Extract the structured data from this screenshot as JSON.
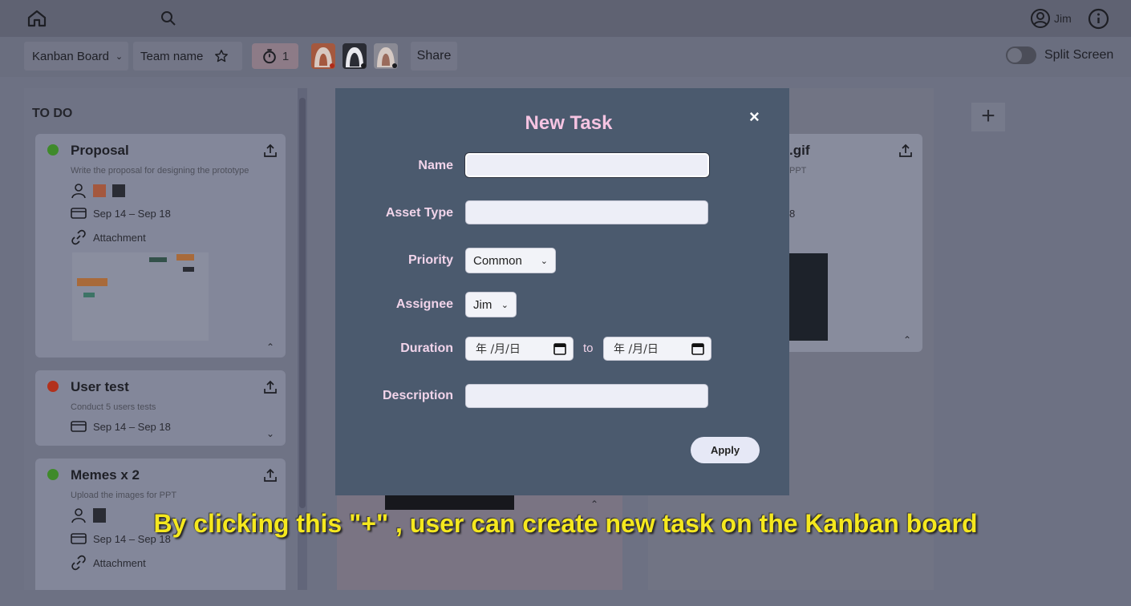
{
  "topbar": {
    "user_name": "Jim"
  },
  "toolbar": {
    "board_select": "Kanban Board",
    "team_name": "Team name",
    "timer_count": "1",
    "share_label": "Share",
    "split_screen_label": "Split Screen"
  },
  "columns": {
    "todo": {
      "title": "TO DO",
      "cards": [
        {
          "title": "Proposal",
          "desc": "Write the proposal for designing the prototype",
          "dates": "Sep 14 – Sep 18",
          "attachment": "Attachment",
          "status_color": "#3f8a2a"
        },
        {
          "title": "User test",
          "desc": "Conduct 5 users tests",
          "dates": "Sep 14 – Sep 18",
          "status_color": "#b2311c"
        },
        {
          "title": "Memes x 2",
          "desc": "Upload the images for PPT",
          "dates": "Sep 14 – Sep 18",
          "attachment": "Attachment",
          "status_color": "#3f8a2a"
        }
      ]
    },
    "right_card": {
      "title_fragment": ".gif",
      "desc_fragment": "PPT",
      "date_fragment": "8"
    }
  },
  "modal": {
    "title": "New Task",
    "close": "×",
    "name_label": "Name",
    "name_value": "",
    "asset_type_label": "Asset Type",
    "asset_type_value": "",
    "priority_label": "Priority",
    "priority_value": "Common",
    "assignee_label": "Assignee",
    "assignee_value": "Jim",
    "duration_label": "Duration",
    "date_from": "年 /月/日",
    "to_label": "to",
    "date_to": "年 /月/日",
    "description_label": "Description",
    "description_value": "",
    "apply_label": "Apply"
  },
  "add_column": "+",
  "caption": "By clicking this \"+\" , user can create new task on the Kanban board"
}
